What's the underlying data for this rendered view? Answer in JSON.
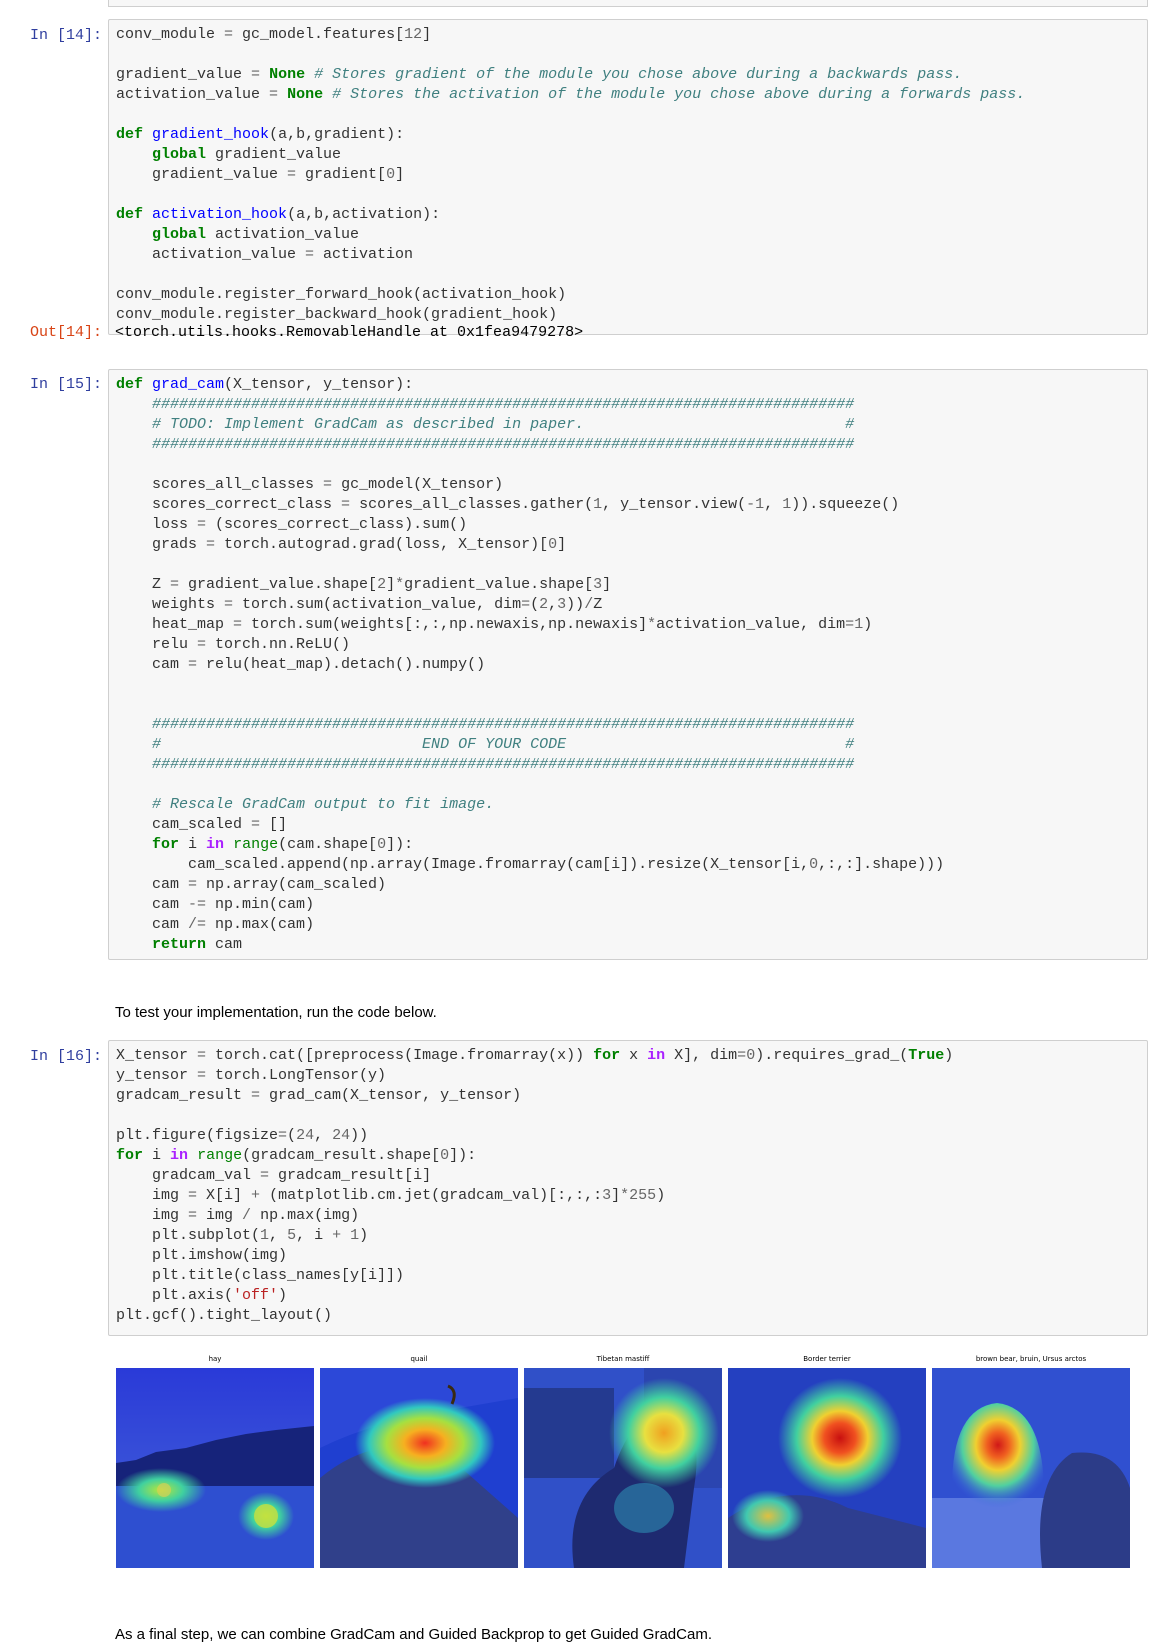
{
  "cells": {
    "c14": {
      "prompt_in": "In [14]:",
      "prompt_out": "Out[14]:",
      "output": "<torch.utils.hooks.RemovableHandle at 0x1fea9479278>",
      "lines": [
        "conv_module = gc_model.features[12]",
        "",
        "gradient_value = None # Stores gradient of the module you chose above during a backwards pass.",
        "activation_value = None # Stores the activation of the module you chose above during a forwards pass.",
        "",
        "def gradient_hook(a,b,gradient):",
        "    global gradient_value",
        "    gradient_value = gradient[0]",
        "",
        "def activation_hook(a,b,activation):",
        "    global activation_value",
        "    activation_value = activation",
        "",
        "conv_module.register_forward_hook(activation_hook)",
        "conv_module.register_backward_hook(gradient_hook)"
      ]
    },
    "c15": {
      "prompt_in": "In [15]:",
      "lines": [
        "def grad_cam(X_tensor, y_tensor):",
        "    ##############################################################################",
        "    # TODO: Implement GradCam as described in paper.                             #",
        "    ##############################################################################",
        "",
        "    scores_all_classes = gc_model(X_tensor)",
        "    scores_correct_class = scores_all_classes.gather(1, y_tensor.view(-1, 1)).squeeze()",
        "    loss = (scores_correct_class).sum()",
        "    grads = torch.autograd.grad(loss, X_tensor)[0]",
        "",
        "    Z = gradient_value.shape[2]*gradient_value.shape[3]",
        "    weights = torch.sum(activation_value, dim=(2,3))/Z",
        "    heat_map = torch.sum(weights[:,:,np.newaxis,np.newaxis]*activation_value, dim=1)",
        "    relu = torch.nn.ReLU()",
        "    cam = relu(heat_map).detach().numpy()",
        "",
        "",
        "    ##############################################################################",
        "    #                             END OF YOUR CODE                               #",
        "    ##############################################################################",
        "",
        "    # Rescale GradCam output to fit image.",
        "    cam_scaled = []",
        "    for i in range(cam.shape[0]):",
        "        cam_scaled.append(np.array(Image.fromarray(cam[i]).resize(X_tensor[i,0,:,:].shape)))",
        "    cam = np.array(cam_scaled)",
        "    cam -= np.min(cam)",
        "    cam /= np.max(cam)",
        "    return cam"
      ]
    },
    "md1": "To test your implementation, run the code below.",
    "c16": {
      "prompt_in": "In [16]:",
      "lines": [
        "X_tensor = torch.cat([preprocess(Image.fromarray(x)) for x in X], dim=0).requires_grad_(True)",
        "y_tensor = torch.LongTensor(y)",
        "gradcam_result = grad_cam(X_tensor, y_tensor)",
        "",
        "plt.figure(figsize=(24, 24))",
        "for i in range(gradcam_result.shape[0]):",
        "    gradcam_val = gradcam_result[i]",
        "    img = X[i] + (matplotlib.cm.jet(gradcam_val)[:,:,:3]*255)",
        "    img = img / np.max(img)",
        "    plt.subplot(1, 5, i + 1)",
        "    plt.imshow(img)",
        "    plt.title(class_names[y[i]])",
        "    plt.axis('off')",
        "plt.gcf().tight_layout()"
      ]
    },
    "figure": {
      "titles": [
        "hay",
        "quail",
        "Tibetan mastiff",
        "Border terrier",
        "brown bear, bruin, Ursus arctos"
      ]
    },
    "md2": "As a final step, we can combine GradCam and Guided Backprop to get Guided GradCam."
  },
  "colors": {
    "prompt_in": "#303f9f",
    "prompt_out": "#d84315",
    "keyword": "#008000",
    "comment": "#408080",
    "function": "#0000ff",
    "string": "#ba2121",
    "cell_bg": "#f7f7f7",
    "cell_border": "#cfcfcf"
  }
}
